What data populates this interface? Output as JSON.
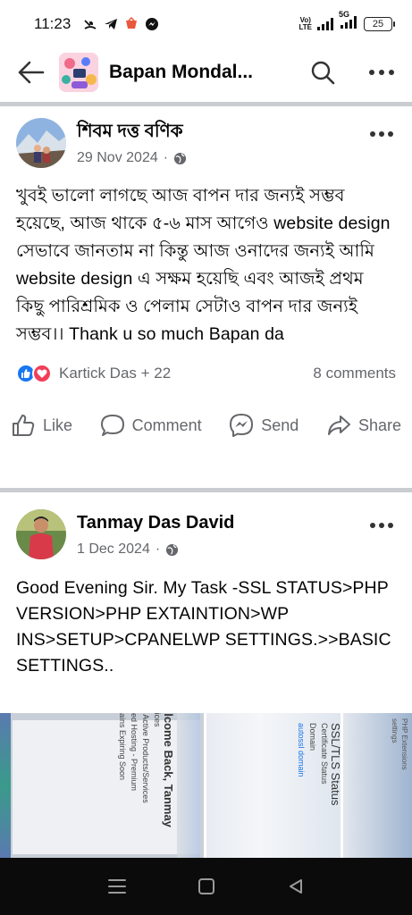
{
  "status_bar": {
    "time": "11:23",
    "network_top": "Vo)",
    "network_bottom": "LTE",
    "network_label": "5G",
    "battery": "25"
  },
  "header": {
    "title": "Bapan Mondal...",
    "back_icon": "arrow-left-icon",
    "search_icon": "search-icon",
    "more_icon": "more-horizontal-icon"
  },
  "posts": [
    {
      "author": "শিবম দত্ত বণিক",
      "date": "29 Nov 2024",
      "separator": "·",
      "privacy_icon": "globe-icon",
      "body": "খুবই ভালো লাগছে আজ বাপন দার জন্যই সম্ভব হয়েছে, আজ থাকে ৫-৬ মাস আগেও website design সেভাবে জানতাম না কিন্তু আজ ওনাদের জন্যই আমি website design এ সক্ষম হয়েছি এবং আজই প্রথম কিছু পারিশ্রমিক ও পেলাম সেটাও বাপন দার জন্যই সম্ভব।। Thank u so much Bapan da",
      "reactions_text": "Kartick Das + 22",
      "comments_text": "8 comments",
      "actions": [
        "Like",
        "Comment",
        "Send",
        "Share"
      ]
    },
    {
      "author": "Tanmay Das David",
      "date": "1 Dec 2024",
      "separator": "·",
      "privacy_icon": "globe-icon",
      "body": "Good Evening Sir. My Task -SSL STATUS>PHP VERSION>PHP EXTAINTION>WP INS>SETUP>CPANELWP SETTINGS.>>BASIC SETTINGS.."
    }
  ],
  "photos": [
    {
      "lines": [
        "Welcome Back, Tanmay",
        "Services",
        "Your Active Products/Services",
        "Shared Hosting - Premium",
        "Domains Expiring Soon"
      ]
    },
    {
      "lines": [
        "SSL/TLS Status",
        "Certificate Status",
        "Domain",
        "autossl domain"
      ]
    },
    {
      "lines": [
        "PHP Extensions",
        "settings"
      ]
    }
  ],
  "nav": {
    "recents_icon": "menu-icon",
    "home_icon": "square-icon",
    "back_icon": "triangle-back-icon"
  },
  "colors": {
    "accent": "#1877f2",
    "love": "#f33e58",
    "secondary_text": "#65676b",
    "divider": "#c9ccd1"
  }
}
